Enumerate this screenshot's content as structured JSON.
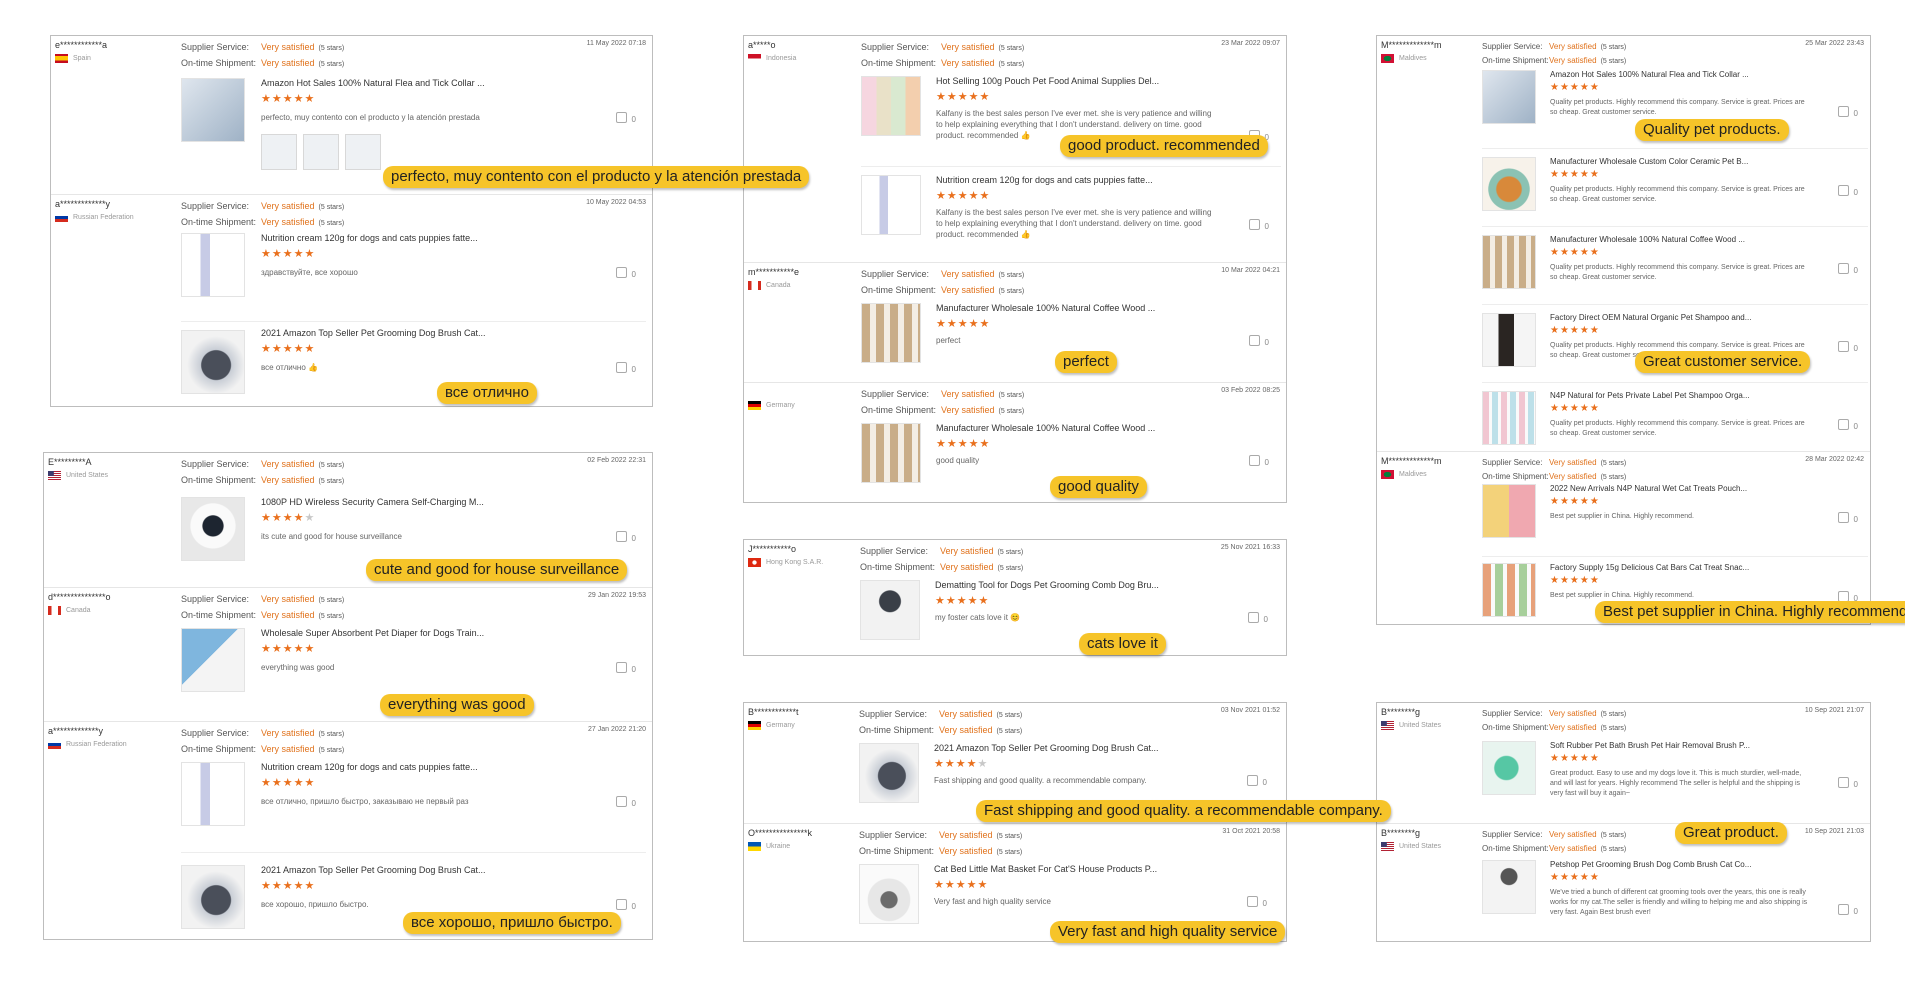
{
  "labels": {
    "supplier_service": "Supplier Service:",
    "on_time_shipment": "On-time Shipment:",
    "satisfied": "Very satisfied",
    "stars_note": "(5 stars)"
  },
  "colors": {
    "accent": "#e0721c",
    "star": "#e9701d",
    "highlight": "#f6c429",
    "border": "#bdbdbd"
  },
  "panels": [
    {
      "id": "p1",
      "reviews": [
        {
          "user": "e************a",
          "country": "Spain",
          "flag": "es",
          "date": "11 May 2022 07:18",
          "products": [
            {
              "title": "Amazon Hot Sales 100% Natural Flea and Tick Collar ...",
              "rating": 5,
              "text": "perfecto, muy contento con el producto y la atención prestada",
              "likes": "0",
              "thumb": "collar"
            }
          ]
        },
        {
          "user": "a*************y",
          "country": "Russian Federation",
          "flag": "ru",
          "date": "10 May 2022 04:53",
          "products": [
            {
              "title": "Nutrition cream 120g for dogs and cats puppies fatte...",
              "rating": 5,
              "text": "здравствуйте, все хорошо",
              "likes": "0",
              "thumb": "cream"
            },
            {
              "title": "2021 Amazon Top Seller Pet Grooming Dog Brush Cat...",
              "rating": 5,
              "text": "все отлично 👍",
              "likes": "0",
              "thumb": "brush"
            }
          ]
        }
      ]
    },
    {
      "id": "p2",
      "reviews": [
        {
          "user": "E*********A",
          "country": "United States",
          "flag": "us",
          "date": "02 Feb 2022 22:31",
          "products": [
            {
              "title": "1080P HD Wireless Security Camera Self-Charging M...",
              "rating": 4,
              "text": "its cute and good for house surveillance",
              "likes": "0",
              "thumb": "camera"
            }
          ]
        },
        {
          "user": "d***************o",
          "country": "Canada",
          "flag": "ca",
          "date": "29 Jan 2022 19:53",
          "products": [
            {
              "title": "Wholesale Super Absorbent Pet Diaper for Dogs Train...",
              "rating": 5,
              "text": "everything was good",
              "likes": "0",
              "thumb": "diaper"
            }
          ]
        },
        {
          "user": "a*************y",
          "country": "Russian Federation",
          "flag": "ru",
          "date": "27 Jan 2022 21:20",
          "products": [
            {
              "title": "Nutrition cream 120g for dogs and cats puppies fatte...",
              "rating": 5,
              "text": "все отлично, пришло быстро, заказываю не первый раз",
              "likes": "0",
              "thumb": "cream"
            },
            {
              "title": "2021 Amazon Top Seller Pet Grooming Dog Brush Cat...",
              "rating": 5,
              "text": "все хорошо, пришло быстро.",
              "likes": "0",
              "thumb": "brush"
            }
          ]
        }
      ]
    },
    {
      "id": "p3",
      "reviews": [
        {
          "user": "a*****o",
          "country": "Indonesia",
          "flag": "id",
          "date": "23 Mar 2022 09:07",
          "products": [
            {
              "title": "Hot Selling 100g Pouch Pet Food Animal Supplies Del...",
              "rating": 5,
              "text": "Kalfany is the best sales person I've ever met. she is very patience and willing to help explaining everything that I don't understand. delivery on time. good product. recommended 👍",
              "likes": "0",
              "thumb": "pouch"
            },
            {
              "title": "Nutrition cream 120g for dogs and cats puppies fatte...",
              "rating": 5,
              "text": "Kalfany is the best sales person I've ever met. she is very patience and willing to help explaining everything that I don't understand. delivery on time. good product. recommended 👍",
              "likes": "0",
              "thumb": "cream"
            }
          ]
        },
        {
          "user": "m***********e",
          "country": "Canada",
          "flag": "ca",
          "date": "10 Mar 2022 04:21",
          "products": [
            {
              "title": "Manufacturer Wholesale 100% Natural Coffee Wood ...",
              "rating": 5,
              "text": "perfect",
              "likes": "0",
              "thumb": "wood"
            }
          ]
        },
        {
          "user": "",
          "country": "Germany",
          "flag": "de",
          "date": "03 Feb 2022 08:25",
          "products": [
            {
              "title": "Manufacturer Wholesale 100% Natural Coffee Wood ...",
              "rating": 5,
              "text": "good quality",
              "likes": "0",
              "thumb": "wood"
            }
          ]
        }
      ]
    },
    {
      "id": "p4",
      "reviews": [
        {
          "user": "J***********o",
          "country": "Hong Kong S.A.R.",
          "flag": "hk",
          "date": "25 Nov 2021 16:33",
          "products": [
            {
              "title": "Dematting Tool for Dogs Pet Grooming Comb Dog Bru...",
              "rating": 5,
              "text": "my foster cats love it 😊",
              "likes": "0",
              "thumb": "comb"
            }
          ]
        }
      ]
    },
    {
      "id": "p5",
      "reviews": [
        {
          "user": "B************t",
          "country": "Germany",
          "flag": "de",
          "date": "03 Nov 2021 01:52",
          "products": [
            {
              "title": "2021 Amazon Top Seller Pet Grooming Dog Brush Cat...",
              "rating": 4,
              "text": "Fast shipping and good quality. a recommendable company.",
              "likes": "0",
              "thumb": "brush"
            }
          ]
        },
        {
          "user": "O***************k",
          "country": "Ukraine",
          "flag": "ua",
          "date": "31 Oct 2021 20:58",
          "products": [
            {
              "title": "Cat Bed Little Mat Basket For Cat'S House Products P...",
              "rating": 5,
              "text": "Very fast and high quality service",
              "likes": "0",
              "thumb": "catbed"
            }
          ]
        }
      ]
    },
    {
      "id": "p6",
      "reviews": [
        {
          "user": "M*************m",
          "country": "Maldives",
          "flag": "mv",
          "date": "25 Mar 2022 23:43",
          "products": [
            {
              "title": "Amazon Hot Sales 100% Natural Flea and Tick Collar ...",
              "rating": 5,
              "text": "Quality pet products. Highly recommend this company. Service is great. Prices are so cheap. Great customer service.",
              "likes": "0",
              "thumb": "collar"
            },
            {
              "title": "Manufacturer Wholesale Custom Color Ceramic Pet B...",
              "rating": 5,
              "text": "Quality pet products. Highly recommend this company. Service is great. Prices are so cheap. Great customer service.",
              "likes": "0",
              "thumb": "bowl"
            },
            {
              "title": "Manufacturer Wholesale 100% Natural Coffee Wood ...",
              "rating": 5,
              "text": "Quality pet products. Highly recommend this company. Service is great. Prices are so cheap. Great customer service.",
              "likes": "0",
              "thumb": "wood"
            },
            {
              "title": "Factory Direct OEM Natural Organic Pet Shampoo and...",
              "rating": 5,
              "text": "Quality pet products. Highly recommend this company. Service is great. Prices are so cheap. Great customer service.",
              "likes": "0",
              "thumb": "shampoo"
            },
            {
              "title": "N4P Natural for Pets Private Label Pet Shampoo Orga...",
              "rating": 5,
              "text": "Quality pet products. Highly recommend this company. Service is great. Prices are so cheap. Great customer service.",
              "likes": "0",
              "thumb": "bottles"
            }
          ]
        },
        {
          "user": "M*************m",
          "country": "Maldives",
          "flag": "mv",
          "date": "28 Mar 2022 02:42",
          "products": [
            {
              "title": "2022 New Arrivals N4P Natural Wet Cat Treats Pouch...",
              "rating": 5,
              "text": "Best pet supplier in China. Highly recommend.",
              "likes": "0",
              "thumb": "pouch"
            },
            {
              "title": "Factory Supply 15g Delicious Cat Bars Cat Treat Snac...",
              "rating": 5,
              "text": "Best pet supplier in China. Highly recommend.",
              "likes": "0",
              "thumb": "bars"
            }
          ]
        }
      ]
    },
    {
      "id": "p7",
      "reviews": [
        {
          "user": "B********g",
          "country": "United States",
          "flag": "us",
          "date": "10 Sep 2021 21:07",
          "products": [
            {
              "title": "Soft Rubber Pet Bath Brush Pet Hair Removal Brush P...",
              "rating": 5,
              "text": "Great product. Easy to use and my dogs love it. This is much sturdier, well-made, and will last for years. Highly recommend The seller is helpful and the shipping is very fast will buy it again~",
              "likes": "0",
              "thumb": "rubber"
            }
          ]
        },
        {
          "user": "B********g",
          "country": "United States",
          "flag": "us",
          "date": "10 Sep 2021 21:03",
          "products": [
            {
              "title": "Petshop Pet Grooming Brush Dog Comb Brush Cat Co...",
              "rating": 5,
              "text": "We've tried a bunch of different cat grooming tools over the years, this one is really works for my cat.The seller is friendly and willing to helping me and also shipping is very fast. Again Best brush ever!",
              "likes": "0",
              "thumb": "roundbrush"
            }
          ]
        }
      ]
    }
  ],
  "highlights": [
    "perfecto, muy contento con el producto y la atención prestada",
    "все отлично",
    "cute and good for house surveillance",
    "everything was good",
    "все хорошо, пришло быстро.",
    "good product. recommended",
    "perfect",
    "good quality",
    "cats love it",
    "Fast shipping and good quality. a recommendable company.",
    "Very fast and high quality service",
    "Quality pet products.",
    "Great customer service.",
    "Best pet supplier in China. Highly recommend.",
    "Great product."
  ]
}
